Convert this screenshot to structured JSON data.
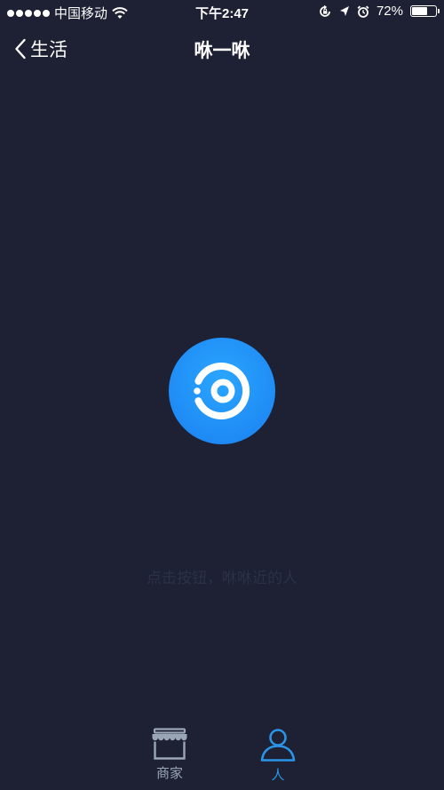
{
  "status_bar": {
    "carrier": "中国移动",
    "time": "下午2:47",
    "battery_percent_text": "72%",
    "battery_level": 0.72,
    "icons": [
      "signal-dots-icon",
      "wifi-icon",
      "rotation-lock-icon",
      "location-icon",
      "alarm-icon",
      "battery-icon"
    ]
  },
  "nav": {
    "back_label": "生活",
    "title": "咻一咻"
  },
  "main": {
    "scan_button_icon": "radar-scan-icon",
    "hint": "点击按钮，咻咻近的人"
  },
  "tabs": [
    {
      "label": "商家",
      "icon": "store-icon",
      "active": false
    },
    {
      "label": "人",
      "icon": "person-icon",
      "active": true
    }
  ],
  "colors": {
    "background": "#1d2133",
    "accent": "#1a8cf0",
    "active_tab": "#2b94e6",
    "inactive_tab": "#9aa6b6",
    "hint_text": "#2b3146"
  }
}
